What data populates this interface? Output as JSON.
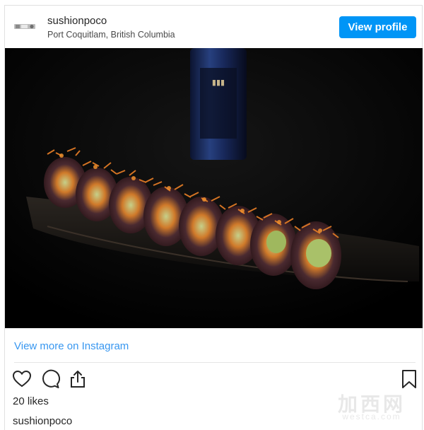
{
  "header": {
    "username": "sushionpoco",
    "location": "Port Coquitlam, British Columbia",
    "view_profile_label": "View profile"
  },
  "post": {
    "image_alt": "sushi roll topped with shredded orange crisps on a dark plate",
    "view_more_label": "View more on Instagram",
    "likes_text": "20 likes",
    "caption_username": "sushionpoco"
  },
  "actions": {
    "icons": [
      "heart-icon",
      "comment-icon",
      "share-icon",
      "bookmark-icon"
    ]
  },
  "watermark": {
    "text_cn": "加西网",
    "text_en": "westca.com"
  },
  "colors": {
    "accent": "#0095f6",
    "link": "#3897f0",
    "text": "#262626"
  }
}
